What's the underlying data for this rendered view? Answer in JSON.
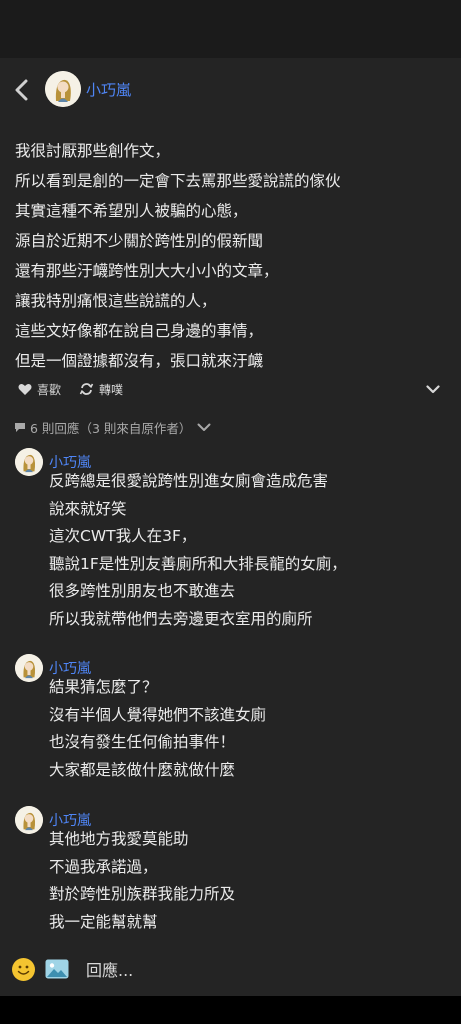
{
  "post": {
    "author": "小巧嵐",
    "lines": [
      "我很討厭那些創作文，",
      "所以看到是創的一定會下去罵那些愛說謊的傢伙",
      "其實這種不希望別人被騙的心態，",
      "源自於近期不少關於跨性別的假新聞",
      "還有那些汙衊跨性別大大小小的文章，",
      "讓我特別痛恨這些說謊的人，",
      "這些文好像都在說自己身邊的事情，",
      "但是一個證據都沒有，張口就來汙衊"
    ]
  },
  "actions": {
    "like_label": "喜歡",
    "repost_label": "轉噗"
  },
  "replies": {
    "count_label": "6 則回應",
    "author_label": "（3 則來自原作者）"
  },
  "comments": [
    {
      "author": "小巧嵐",
      "lines": [
        "反跨總是很愛說跨性別進女廁會造成危害",
        "說來就好笑",
        "這次CWT我人在3F，",
        "聽說1F是性別友善廁所和大排長龍的女廁，",
        "很多跨性別朋友也不敢進去",
        "所以我就帶他們去旁邊更衣室用的廁所"
      ]
    },
    {
      "author": "小巧嵐",
      "lines": [
        "結果猜怎麼了？",
        "沒有半個人覺得她們不該進女廁",
        "也沒有發生任何偷拍事件！",
        "大家都是該做什麼就做什麼"
      ]
    },
    {
      "author": "小巧嵐",
      "lines": [
        "其他地方我愛莫能助",
        "不過我承諾過，",
        "對於跨性別族群我能力所及",
        "我一定能幫就幫"
      ]
    }
  ],
  "composer": {
    "placeholder": "回應..."
  },
  "icons": {
    "back": "chevron-left-icon",
    "like": "heart-icon",
    "repost": "repost-icon",
    "expand": "chevron-down-icon",
    "replies": "speech-bubble-icon",
    "emoji": "emoji-icon",
    "image": "image-icon"
  },
  "colors": {
    "background": "#242424",
    "author_link": "#4f86f7",
    "text": "#ebebeb",
    "muted": "#a9a9a9"
  }
}
